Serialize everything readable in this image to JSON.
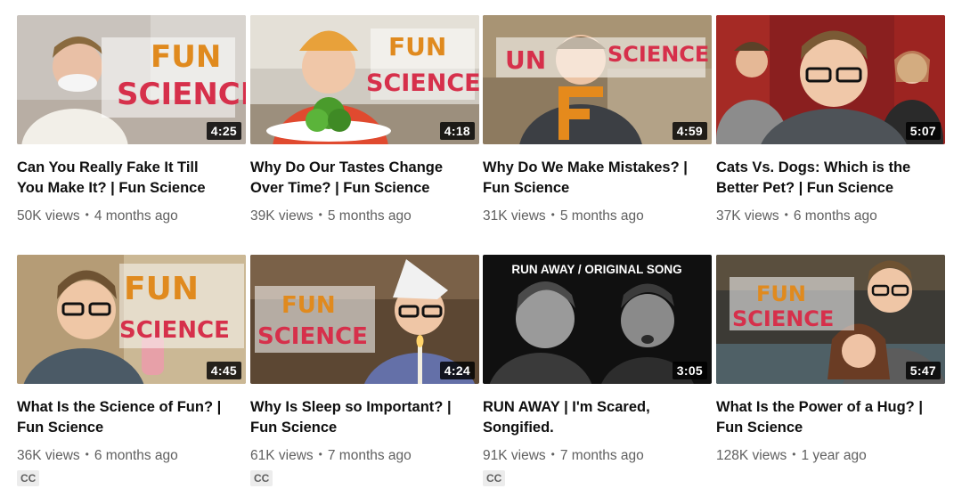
{
  "colors": {
    "title": "#0f0f0f",
    "meta": "#606060",
    "badge_bg": "#000000"
  },
  "videos": [
    {
      "title_line1": "Can You Really Fake It Till",
      "title_line2": "You Make It? | Fun Science",
      "views": "50K views",
      "age": "4 months ago",
      "duration": "4:25",
      "cc": ""
    },
    {
      "title_line1": "Why Do Our Tastes Change",
      "title_line2": "Over Time? | Fun Science",
      "views": "39K views",
      "age": "5 months ago",
      "duration": "4:18",
      "cc": ""
    },
    {
      "title_line1": "Why Do We Make Mistakes? |",
      "title_line2": "Fun Science",
      "views": "31K views",
      "age": "5 months ago",
      "duration": "4:59",
      "cc": ""
    },
    {
      "title_line1": "Cats Vs. Dogs: Which is the",
      "title_line2": "Better Pet? | Fun Science",
      "views": "37K views",
      "age": "6 months ago",
      "duration": "5:07",
      "cc": ""
    },
    {
      "title_line1": "What Is the Science of Fun? |",
      "title_line2": "Fun Science",
      "views": "36K views",
      "age": "6 months ago",
      "duration": "4:45",
      "cc": "CC"
    },
    {
      "title_line1": "Why Is Sleep so Important? |",
      "title_line2": "Fun Science",
      "views": "61K views",
      "age": "7 months ago",
      "duration": "4:24",
      "cc": "CC"
    },
    {
      "title_line1": "RUN AWAY | I'm Scared,",
      "title_line2": "Songified.",
      "views": "91K views",
      "age": "7 months ago",
      "duration": "3:05",
      "cc": "CC"
    },
    {
      "title_line1": "What Is the Power of a Hug? |",
      "title_line2": "Fun Science",
      "views": "128K views",
      "age": "1 year ago",
      "duration": "5:47",
      "cc": ""
    }
  ],
  "thumb_text": {
    "fun": "FUN",
    "science": "SCIENCE",
    "run_away_banner": "RUN AWAY / ORIGINAL SONG"
  }
}
